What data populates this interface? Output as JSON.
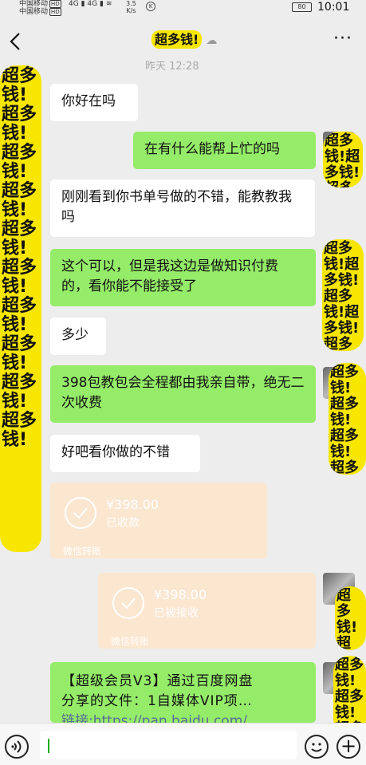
{
  "status_bar": {
    "carrier1": "中国移动",
    "carrier2": "中国移动",
    "hd": "HD",
    "net1": "4G",
    "net2": "4G",
    "speed_value": "3.5",
    "speed_unit": "K/s",
    "k_badge": "K",
    "battery": "80",
    "time": "10:01"
  },
  "header": {
    "title": "超多钱!",
    "timestamp": "昨天 12:28"
  },
  "messages": [
    {
      "side": "left",
      "text": "你好在吗"
    },
    {
      "side": "right",
      "text": "在有什么能帮上忙的吗"
    },
    {
      "side": "left",
      "text": "刚刚看到你书单号做的不错，能教教我吗"
    },
    {
      "side": "left",
      "text": "这个可以，但是我这边是做知识付费的，看你能不能接受了"
    },
    {
      "side": "left",
      "text": "多少"
    },
    {
      "side": "left",
      "text": "398包教包会全程都由我亲自带，绝无二次收费"
    },
    {
      "side": "left",
      "text": "好吧看你做的不错"
    }
  ],
  "transfers": [
    {
      "amount": "¥398.00",
      "status": "已收款",
      "footer": "微信转账"
    },
    {
      "amount": "¥398.00",
      "status": "已被接收",
      "footer": "微信转账"
    }
  ],
  "last_message": {
    "line1": "【超级会员V3】通过百度网盘",
    "line2": "分享的文件：1自媒体VIP项…",
    "line3": "链接:https://pan.baidu.com/"
  },
  "scribble_text": "超多钱!超多钱!超多钱!超多钱!超多钱!超多钱!超多钱!超多钱!超多钱!超多钱!",
  "colors": {
    "background": "#ededed",
    "bubble_right": "#95ec69",
    "bubble_left": "#ffffff",
    "transfer": "#fbe6d0",
    "scribble": "#f6e600"
  },
  "icons": [
    "back-arrow-icon",
    "more-icon",
    "voice-icon",
    "emoji-icon",
    "plus-icon",
    "cloud-icon"
  ]
}
